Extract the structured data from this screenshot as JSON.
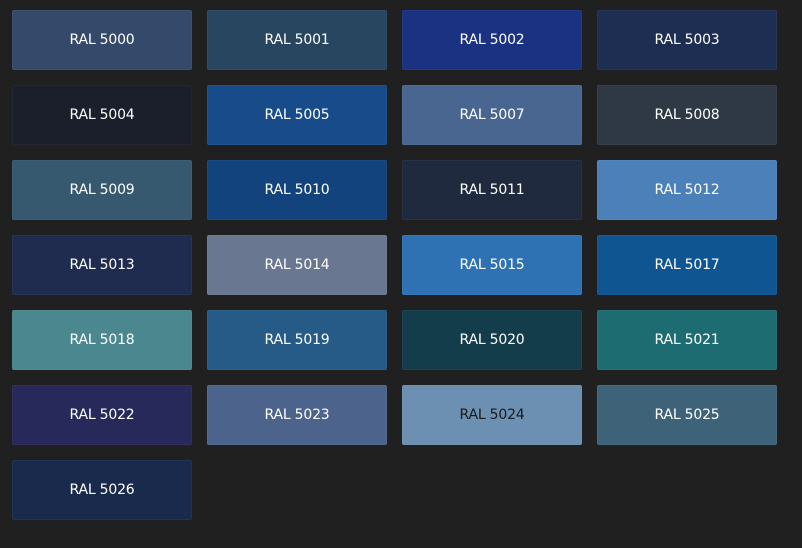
{
  "swatches": [
    {
      "label": "RAL 5000",
      "color": "#354a6b",
      "text_color": "#ffffff"
    },
    {
      "label": "RAL 5001",
      "color": "#294661",
      "text_color": "#ffffff"
    },
    {
      "label": "RAL 5002",
      "color": "#1b3282",
      "text_color": "#ffffff"
    },
    {
      "label": "RAL 5003",
      "color": "#1e2d52",
      "text_color": "#ffffff"
    },
    {
      "label": "RAL 5004",
      "color": "#1a1f2b",
      "text_color": "#ffffff"
    },
    {
      "label": "RAL 5005",
      "color": "#174b8a",
      "text_color": "#ffffff"
    },
    {
      "label": "RAL 5007",
      "color": "#486690",
      "text_color": "#ffffff"
    },
    {
      "label": "RAL 5008",
      "color": "#2e3945",
      "text_color": "#ffffff"
    },
    {
      "label": "RAL 5009",
      "color": "#36596f",
      "text_color": "#ffffff"
    },
    {
      "label": "RAL 5010",
      "color": "#12437c",
      "text_color": "#ffffff"
    },
    {
      "label": "RAL 5011",
      "color": "#202a3e",
      "text_color": "#ffffff"
    },
    {
      "label": "RAL 5012",
      "color": "#4b80b9",
      "text_color": "#ffffff"
    },
    {
      "label": "RAL 5013",
      "color": "#1f2c4f",
      "text_color": "#ffffff"
    },
    {
      "label": "RAL 5014",
      "color": "#6a7791",
      "text_color": "#ffffff"
    },
    {
      "label": "RAL 5015",
      "color": "#2f72b3",
      "text_color": "#ffffff"
    },
    {
      "label": "RAL 5017",
      "color": "#0f5592",
      "text_color": "#ffffff"
    },
    {
      "label": "RAL 5018",
      "color": "#4a878e",
      "text_color": "#ffffff"
    },
    {
      "label": "RAL 5019",
      "color": "#265a87",
      "text_color": "#ffffff"
    },
    {
      "label": "RAL 5020",
      "color": "#143d4b",
      "text_color": "#ffffff"
    },
    {
      "label": "RAL 5021",
      "color": "#1d6c72",
      "text_color": "#ffffff"
    },
    {
      "label": "RAL 5022",
      "color": "#27295a",
      "text_color": "#ffffff"
    },
    {
      "label": "RAL 5023",
      "color": "#4c638c",
      "text_color": "#ffffff"
    },
    {
      "label": "RAL 5024",
      "color": "#6b90b2",
      "text_color": "#1a1a1a"
    },
    {
      "label": "RAL 5025",
      "color": "#3e6379",
      "text_color": "#ffffff"
    },
    {
      "label": "RAL 5026",
      "color": "#1a2a4d",
      "text_color": "#ffffff"
    }
  ]
}
